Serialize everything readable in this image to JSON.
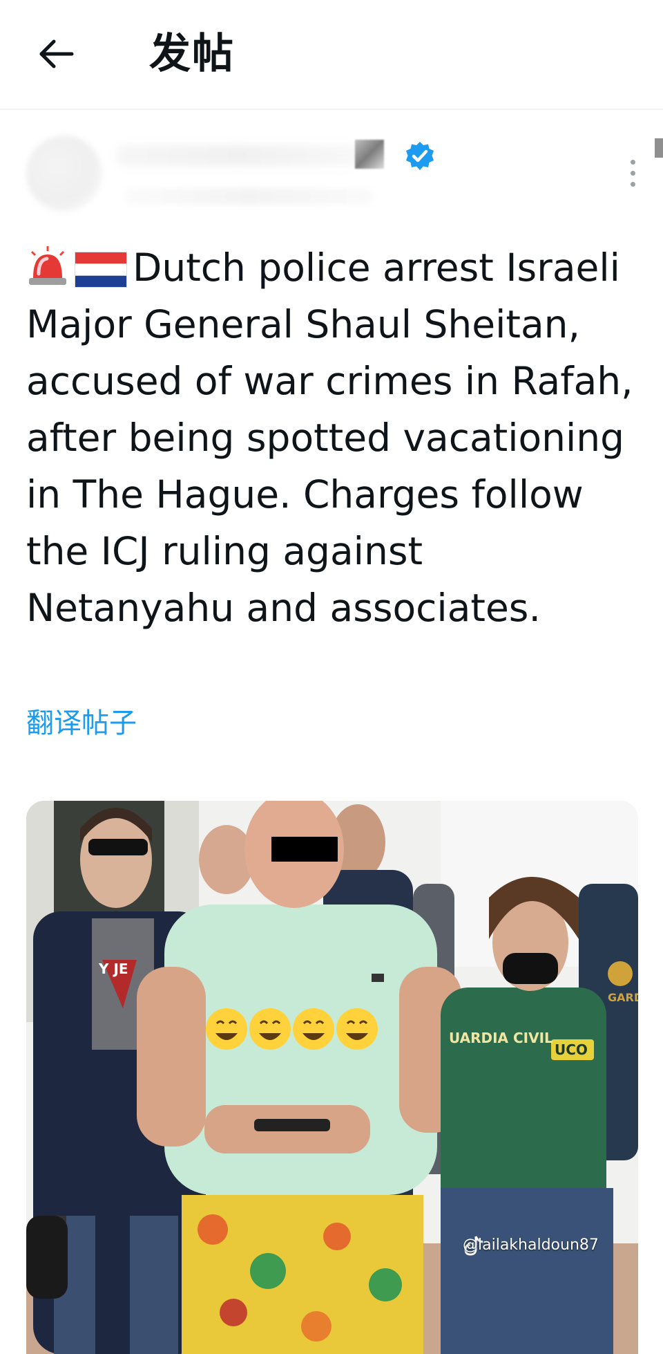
{
  "header": {
    "title": "发帖"
  },
  "post": {
    "text": "Dutch police arrest Israeli Major General Shaul Sheitan, accused of war crimes in Rafah, after being spotted vacationing in The Hague. Charges follow the ICJ ruling against Netanyahu and associates.",
    "translate_label": "翻译帖子",
    "leading_emojis": [
      "police-car-light-emoji",
      "netherlands-flag-emoji"
    ]
  },
  "media": {
    "vest_text": "UARDIA CIVIL",
    "badge_text": "UCO",
    "shirt_text": "Y JE",
    "patch_text": "GARD",
    "watermark": "@lailakhaldoun87"
  },
  "colors": {
    "accent": "#1d9bf0",
    "text": "#0f1419",
    "divider": "#eff3f4"
  }
}
